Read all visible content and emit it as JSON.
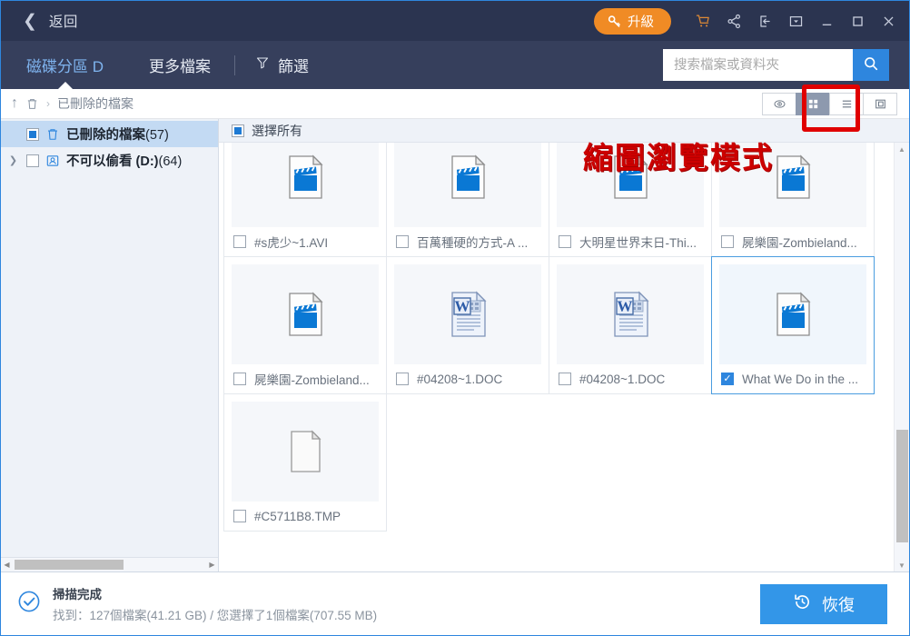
{
  "titlebar": {
    "back_label": "返回",
    "back_icon": "chevron-left-icon",
    "upgrade_label": "升級",
    "upgrade_icon": "key-icon",
    "accent_orange": "#f08b25",
    "background": "#2b3450",
    "icons": [
      {
        "name": "cart-icon",
        "glyph": "cart"
      },
      {
        "name": "share-icon",
        "glyph": "share"
      },
      {
        "name": "login-icon",
        "glyph": "login"
      },
      {
        "name": "dropdown-menu-icon",
        "glyph": "caret-box"
      },
      {
        "name": "minimize-icon",
        "glyph": "minimize"
      },
      {
        "name": "maximize-icon",
        "glyph": "maximize"
      },
      {
        "name": "close-icon",
        "glyph": "close"
      }
    ]
  },
  "tabbar": {
    "background": "#363f5c",
    "tabs": [
      {
        "label": "磁碟分區 D",
        "active": true
      },
      {
        "label": "更多檔案",
        "active": false
      }
    ],
    "filter_label": "篩選",
    "filter_icon": "funnel-icon",
    "search": {
      "placeholder": "搜索檔案或資料夾",
      "value": "",
      "button_icon": "search-icon",
      "button_color": "#2e86de"
    }
  },
  "breadcrumb": {
    "up_icon": "arrow-up-icon",
    "root_icon": "trash-icon",
    "separator": "›",
    "path": "已刪除的檔案",
    "view_buttons": [
      {
        "name": "preview-eye-icon",
        "active": false
      },
      {
        "name": "grid-view-icon",
        "active": true
      },
      {
        "name": "list-view-icon",
        "active": false
      },
      {
        "name": "detail-pane-icon",
        "active": false
      }
    ]
  },
  "annotations": {
    "highlight_color": "#e00000",
    "callout_text": "縮圖瀏覽模式"
  },
  "sidebar": {
    "items": [
      {
        "label_main": "已刪除的檔案",
        "count": "(57)",
        "icon": "trash-icon",
        "checkbox": "partial",
        "expandable": false,
        "selected": true
      },
      {
        "label_main": "不可以偷看 (D:)",
        "count": "(64)",
        "icon": "drive-icon",
        "checkbox": "unchecked",
        "expandable": true,
        "selected": false
      }
    ]
  },
  "filepanel": {
    "select_all_label": "選擇所有",
    "select_all_state": "partial",
    "files": [
      {
        "name": "#s虎少~1.AVI",
        "type": "video",
        "checked": false
      },
      {
        "name": "百萬種硬的方式-A ...",
        "type": "video",
        "checked": false
      },
      {
        "name": "大明星世界末日-Thi...",
        "type": "video",
        "checked": false
      },
      {
        "name": "屍樂園-Zombieland...",
        "type": "video",
        "checked": false
      },
      {
        "name": "屍樂園-Zombieland...",
        "type": "video",
        "checked": false
      },
      {
        "name": "#04208~1.DOC",
        "type": "word",
        "checked": false
      },
      {
        "name": "#04208~1.DOC",
        "type": "word",
        "checked": false
      },
      {
        "name": "What We Do in the ...",
        "type": "video",
        "checked": true
      },
      {
        "name": "#C5711B8.TMP",
        "type": "blank",
        "checked": false
      }
    ]
  },
  "footer": {
    "status_icon": "check-circle-icon",
    "status_title": "掃描完成",
    "status_detail": "找到：127個檔案(41.21 GB) / 您選擇了1個檔案(707.55 MB)",
    "recover_label": "恢復",
    "recover_icon": "restore-icon",
    "recover_color": "#3396e8"
  }
}
